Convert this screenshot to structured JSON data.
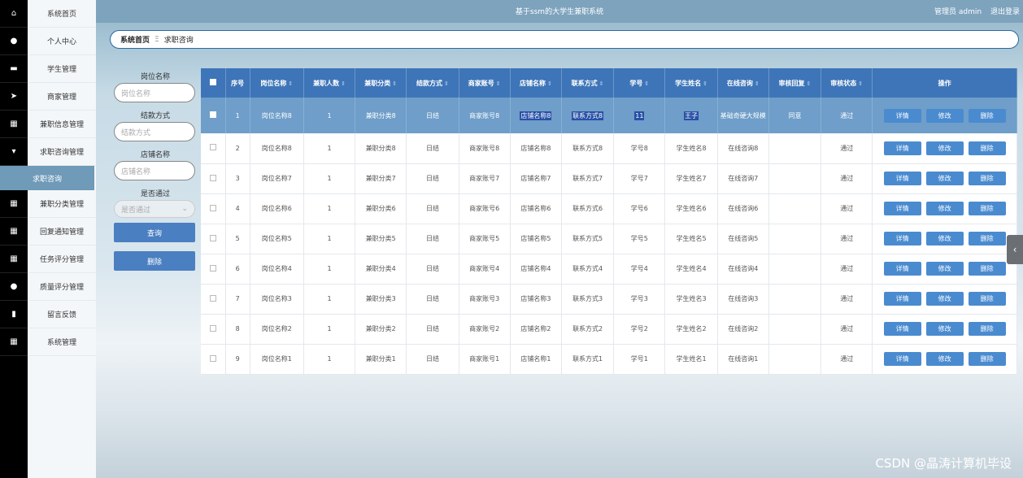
{
  "rail": {
    "icons": [
      "home-icon",
      "user-icon",
      "briefcase-icon",
      "send-icon",
      "grid-icon",
      "chat-icon",
      "dot-icon",
      "grid-icon",
      "grid-icon",
      "grid-icon",
      "pin-icon",
      "chart-icon",
      "grid-icon"
    ]
  },
  "sidebar": {
    "items": [
      {
        "label": "系统首页"
      },
      {
        "label": "个人中心"
      },
      {
        "label": "学生管理"
      },
      {
        "label": "商家管理"
      },
      {
        "label": "兼职信息管理"
      },
      {
        "label": "求职咨询管理"
      },
      {
        "label": "求职咨询"
      },
      {
        "label": "兼职分类管理"
      },
      {
        "label": "回复通知管理"
      },
      {
        "label": "任务评分管理"
      },
      {
        "label": "质量评分管理"
      },
      {
        "label": "留言反馈"
      },
      {
        "label": "系统管理"
      }
    ],
    "active_index": 6
  },
  "header": {
    "title": "基于ssm的大学生兼职系统",
    "user": "管理员 admin",
    "logout": "退出登录"
  },
  "breadcrumb": {
    "home": "系统首页",
    "separator": "Ξ",
    "current": "求职咨询"
  },
  "search": {
    "f1_label": "岗位名称",
    "f1_placeholder": "岗位名称",
    "f2_label": "结款方式",
    "f2_placeholder": "结款方式",
    "f3_label": "店铺名称",
    "f3_placeholder": "店铺名称",
    "f4_label": "是否通过",
    "f4_placeholder": "是否通过",
    "query_btn": "查询",
    "delete_btn": "删除"
  },
  "table": {
    "headers": [
      "序号",
      "岗位名称",
      "兼职人数",
      "兼职分类",
      "结款方式",
      "商家账号",
      "店铺名称",
      "联系方式",
      "学号",
      "学生姓名",
      "在线咨询",
      "审核回复",
      "审核状态",
      "操作"
    ],
    "rows": [
      {
        "no": "1",
        "job": "岗位名称8",
        "count": "1",
        "cat": "兼职分类8",
        "pay": "日结",
        "acct": "商家账号8",
        "shop": "店铺名称8",
        "contact": "联系方式8",
        "sid": "11",
        "sname": "王子",
        "consult": "基础奇硬大规模",
        "reply": "同意",
        "status": "通过"
      },
      {
        "no": "2",
        "job": "岗位名称8",
        "count": "1",
        "cat": "兼职分类8",
        "pay": "日结",
        "acct": "商家账号8",
        "shop": "店铺名称8",
        "contact": "联系方式8",
        "sid": "学号8",
        "sname": "学生姓名8",
        "consult": "在线咨询8",
        "reply": "",
        "status": "通过"
      },
      {
        "no": "3",
        "job": "岗位名称7",
        "count": "1",
        "cat": "兼职分类7",
        "pay": "日结",
        "acct": "商家账号7",
        "shop": "店铺名称7",
        "contact": "联系方式7",
        "sid": "学号7",
        "sname": "学生姓名7",
        "consult": "在线咨询7",
        "reply": "",
        "status": "通过"
      },
      {
        "no": "4",
        "job": "岗位名称6",
        "count": "1",
        "cat": "兼职分类6",
        "pay": "日结",
        "acct": "商家账号6",
        "shop": "店铺名称6",
        "contact": "联系方式6",
        "sid": "学号6",
        "sname": "学生姓名6",
        "consult": "在线咨询6",
        "reply": "",
        "status": "通过"
      },
      {
        "no": "5",
        "job": "岗位名称5",
        "count": "1",
        "cat": "兼职分类5",
        "pay": "日结",
        "acct": "商家账号5",
        "shop": "店铺名称5",
        "contact": "联系方式5",
        "sid": "学号5",
        "sname": "学生姓名5",
        "consult": "在线咨询5",
        "reply": "",
        "status": "通过"
      },
      {
        "no": "6",
        "job": "岗位名称4",
        "count": "1",
        "cat": "兼职分类4",
        "pay": "日结",
        "acct": "商家账号4",
        "shop": "店铺名称4",
        "contact": "联系方式4",
        "sid": "学号4",
        "sname": "学生姓名4",
        "consult": "在线咨询4",
        "reply": "",
        "status": "通过"
      },
      {
        "no": "7",
        "job": "岗位名称3",
        "count": "1",
        "cat": "兼职分类3",
        "pay": "日结",
        "acct": "商家账号3",
        "shop": "店铺名称3",
        "contact": "联系方式3",
        "sid": "学号3",
        "sname": "学生姓名3",
        "consult": "在线咨询3",
        "reply": "",
        "status": "通过"
      },
      {
        "no": "8",
        "job": "岗位名称2",
        "count": "1",
        "cat": "兼职分类2",
        "pay": "日结",
        "acct": "商家账号2",
        "shop": "店铺名称2",
        "contact": "联系方式2",
        "sid": "学号2",
        "sname": "学生姓名2",
        "consult": "在线咨询2",
        "reply": "",
        "status": "通过"
      },
      {
        "no": "9",
        "job": "岗位名称1",
        "count": "1",
        "cat": "兼职分类1",
        "pay": "日结",
        "acct": "商家账号1",
        "shop": "店铺名称1",
        "contact": "联系方式1",
        "sid": "学号1",
        "sname": "学生姓名1",
        "consult": "在线咨询1",
        "reply": "",
        "status": "通过"
      }
    ],
    "op_labels": {
      "detail": "详情",
      "edit": "修改",
      "delete": "删除"
    }
  },
  "watermark": "CSDN @晶涛计算机毕设"
}
